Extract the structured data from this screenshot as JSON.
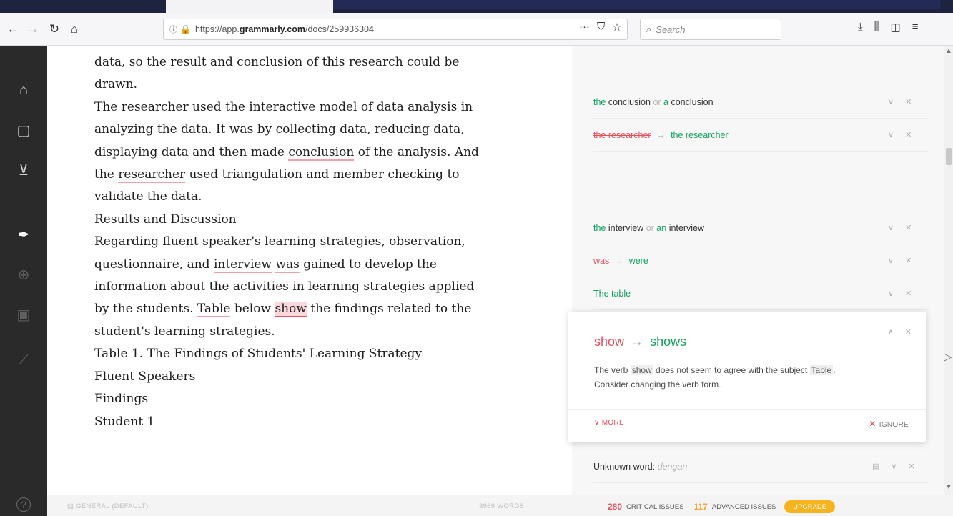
{
  "browser": {
    "url_prefix": "https://app.",
    "url_host": "grammarly.com",
    "url_path": "/docs/259936304",
    "search_placeholder": "Search",
    "icons": [
      "back-icon",
      "forward-icon",
      "reload-icon",
      "home-icon",
      "info-icon",
      "lock-icon",
      "more-icon",
      "pocket-icon",
      "bookmark-star-icon",
      "search-icon",
      "download-icon",
      "library-icon",
      "sidebar-icon",
      "menu-icon"
    ]
  },
  "sidebar": {
    "icons": [
      "home-icon",
      "document-icon",
      "download-box-icon",
      "pen-nib-icon",
      "magnify-icon",
      "book-icon",
      "wand-icon",
      "help-icon"
    ]
  },
  "document": {
    "lines": [
      {
        "segments": [
          {
            "t": "data, so the result and conclusion of this research could be"
          }
        ]
      },
      {
        "segments": [
          {
            "t": "drawn."
          }
        ]
      },
      {
        "segments": [
          {
            "t": "The researcher used the interactive model of data analysis in"
          }
        ]
      },
      {
        "segments": [
          {
            "t": "analyzing the data. It was by collecting data, reducing data,"
          }
        ]
      },
      {
        "segments": [
          {
            "t": "displaying data and then made "
          },
          {
            "t": "conclusion",
            "u": true
          },
          {
            "t": " of the analysis. And"
          }
        ]
      },
      {
        "segments": [
          {
            "t": "the  "
          },
          {
            "t": "researcher",
            "u": true
          },
          {
            "t": " used triangulation and member checking to"
          }
        ]
      },
      {
        "segments": [
          {
            "t": "validate the data."
          }
        ]
      },
      {
        "segments": [
          {
            "t": "Results and Discussion"
          }
        ]
      },
      {
        "segments": [
          {
            "t": "Regarding fluent speaker's learning strategies, observation,"
          }
        ]
      },
      {
        "segments": [
          {
            "t": "questionnaire, and "
          },
          {
            "t": "interview",
            "u": true
          },
          {
            "t": " "
          },
          {
            "t": "was",
            "u": true
          },
          {
            "t": " gained to develop the"
          }
        ]
      },
      {
        "segments": [
          {
            "t": "information about the activities in learning strategies applied"
          }
        ]
      },
      {
        "segments": [
          {
            "t": "by the students. "
          },
          {
            "t": "Table",
            "u": true
          },
          {
            "t": " below "
          },
          {
            "t": "show",
            "hl": true
          },
          {
            "t": " the findings related to the"
          }
        ]
      },
      {
        "segments": [
          {
            "t": "student's learning strategies."
          }
        ]
      },
      {
        "segments": [
          {
            "t": "Table 1. The Findings of Students' Learning Strategy"
          }
        ]
      },
      {
        "segments": [
          {
            "t": "Fluent Speakers"
          }
        ]
      },
      {
        "segments": [
          {
            "t": "Findings"
          }
        ]
      },
      {
        "segments": [
          {
            "t": "Student 1"
          }
        ]
      }
    ]
  },
  "suggestions": {
    "card1": {
      "a": "the",
      "a_word": "conclusion",
      "or": "or",
      "b": "a",
      "b_word": "conclusion"
    },
    "card2": {
      "old": "the researcher",
      "arrow": "→",
      "new": "the researcher"
    },
    "card3": {
      "a": "the",
      "a_word": "interview",
      "or": "or",
      "b": "an",
      "b_word": "interview"
    },
    "card4": {
      "old": "was",
      "arrow": "→",
      "new": "were"
    },
    "card5": {
      "text": "The table"
    },
    "expanded": {
      "old": "show",
      "arrow": "→",
      "new": "shows",
      "desc_1": "The verb ",
      "desc_chip1": "show",
      "desc_2": " does not seem to agree with the subject ",
      "desc_chip2": "Table",
      "desc_3": ".",
      "desc_line2": "Consider changing the verb form.",
      "more_label": "MORE",
      "ignore_label": "IGNORE"
    },
    "card6": {
      "label": "Unknown word:",
      "word": "dengan"
    }
  },
  "statusbar": {
    "mode": "GENERAL (DEFAULT)",
    "words": "3969 WORDS",
    "critical_count": "280",
    "critical_label": "CRITICAL ISSUES",
    "advanced_count": "117",
    "advanced_label": "ADVANCED ISSUES",
    "upgrade_label": "UPGRADE"
  }
}
